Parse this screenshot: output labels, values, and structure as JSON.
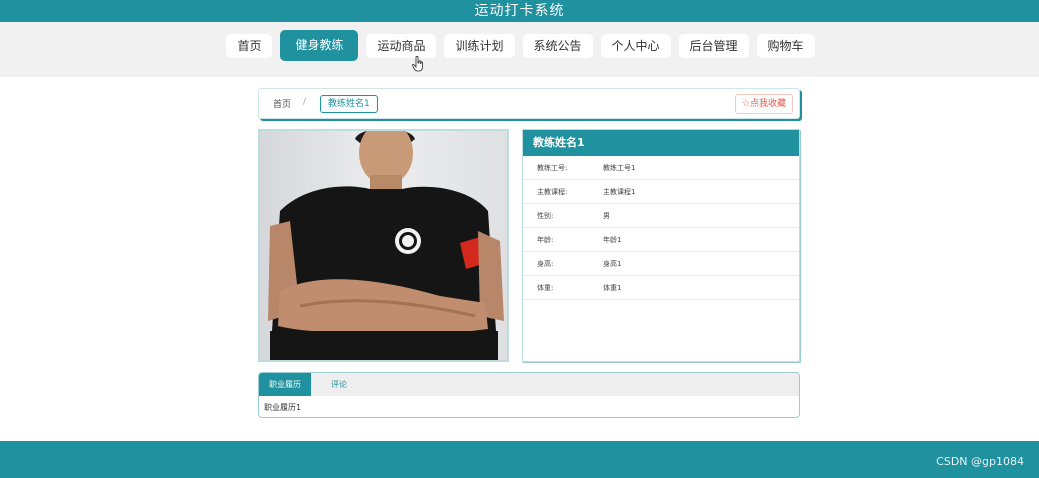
{
  "header": {
    "title": "运动打卡系统"
  },
  "nav": {
    "items": [
      {
        "label": "首页"
      },
      {
        "label": "健身教练"
      },
      {
        "label": "运动商品"
      },
      {
        "label": "训练计划"
      },
      {
        "label": "系统公告"
      },
      {
        "label": "个人中心"
      },
      {
        "label": "后台管理"
      },
      {
        "label": "购物车"
      }
    ],
    "active_index": 1
  },
  "breadcrumb": {
    "home": "首页",
    "separator": "/",
    "current": "教练姓名1"
  },
  "favorite_button": {
    "icon": "star-outline-icon",
    "label": "☆点我收藏"
  },
  "coach": {
    "name": "教练姓名1",
    "fields": [
      {
        "key": "教练工号:",
        "value": "教练工号1"
      },
      {
        "key": "主教课程:",
        "value": "主教课程1"
      },
      {
        "key": "性别:",
        "value": "男"
      },
      {
        "key": "年龄:",
        "value": "年龄1"
      },
      {
        "key": "身高:",
        "value": "身高1"
      },
      {
        "key": "体重:",
        "value": "体重1"
      }
    ]
  },
  "tabs": {
    "items": [
      {
        "label": "职业履历"
      },
      {
        "label": "评论"
      }
    ],
    "active_content": "职业履历1"
  },
  "footer": {
    "watermark": "CSDN @gp1084"
  },
  "colors": {
    "primary": "#1f919f",
    "nav_band": "#f1f1f1",
    "favorite": "#e85a4a"
  }
}
